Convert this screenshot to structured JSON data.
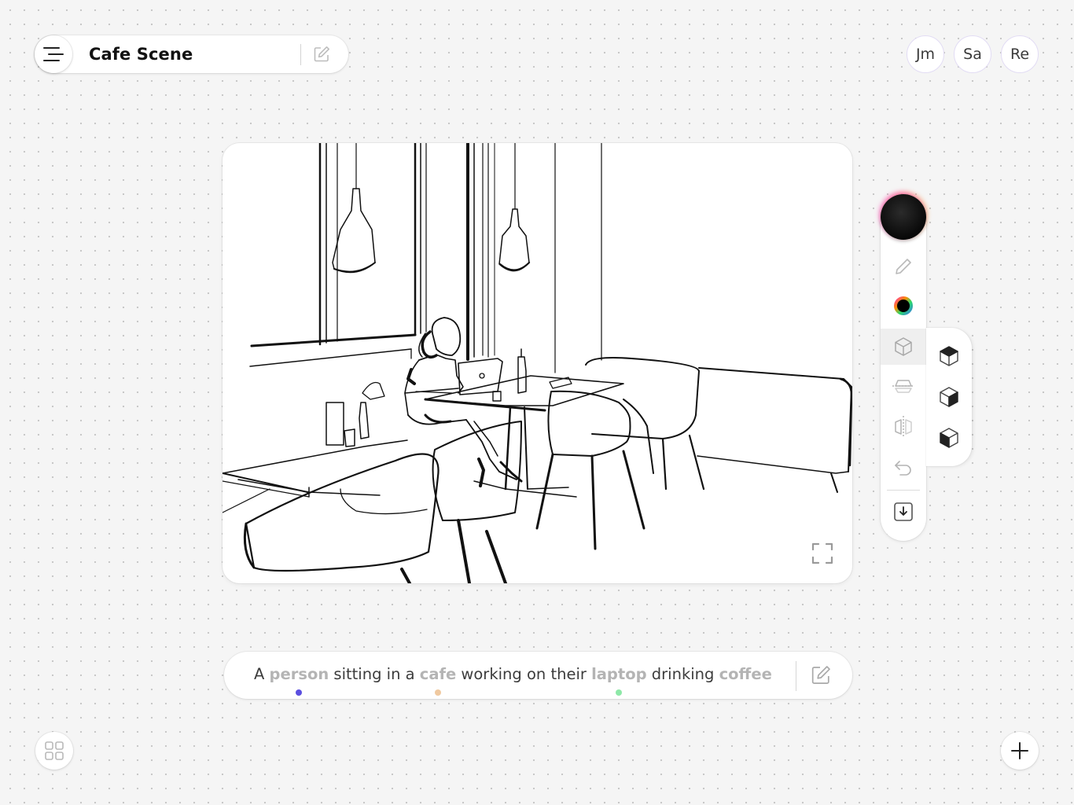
{
  "header": {
    "title": "Cafe Scene",
    "menu_icon": "hamburger-menu-icon",
    "edit_icon": "edit-icon"
  },
  "collaborators": [
    "Jm",
    "Sa",
    "Re"
  ],
  "canvas": {
    "fullscreen_icon": "fullscreen-icon"
  },
  "toolbar": {
    "current_color": "#111111",
    "tools": [
      "pencil-icon",
      "color-wheel-icon",
      "cube-icon",
      "horizontal-flip-plane-icon",
      "vertical-mirror-icon",
      "undo-icon",
      "download-icon"
    ],
    "active_tool": "cube-icon",
    "shade_options": [
      "cube-top-dark-icon",
      "cube-right-dark-icon",
      "cube-left-dark-icon"
    ]
  },
  "prompt": {
    "segments": [
      {
        "text": "A ",
        "keyword": false
      },
      {
        "text": "person",
        "keyword": true,
        "dot_color": "#5b4fe0"
      },
      {
        "text": " sitting in a ",
        "keyword": false
      },
      {
        "text": "cafe",
        "keyword": true,
        "dot_color": "#f0c9a0"
      },
      {
        "text": " working on their ",
        "keyword": false
      },
      {
        "text": "laptop",
        "keyword": true,
        "dot_color": "#8ee8a8"
      },
      {
        "text": " drinking ",
        "keyword": false
      },
      {
        "text": "coffee",
        "keyword": true,
        "dot_color": ""
      }
    ],
    "edit_icon": "edit-icon"
  },
  "bottom": {
    "grid_icon": "grid-view-icon",
    "add_icon": "plus-icon"
  }
}
